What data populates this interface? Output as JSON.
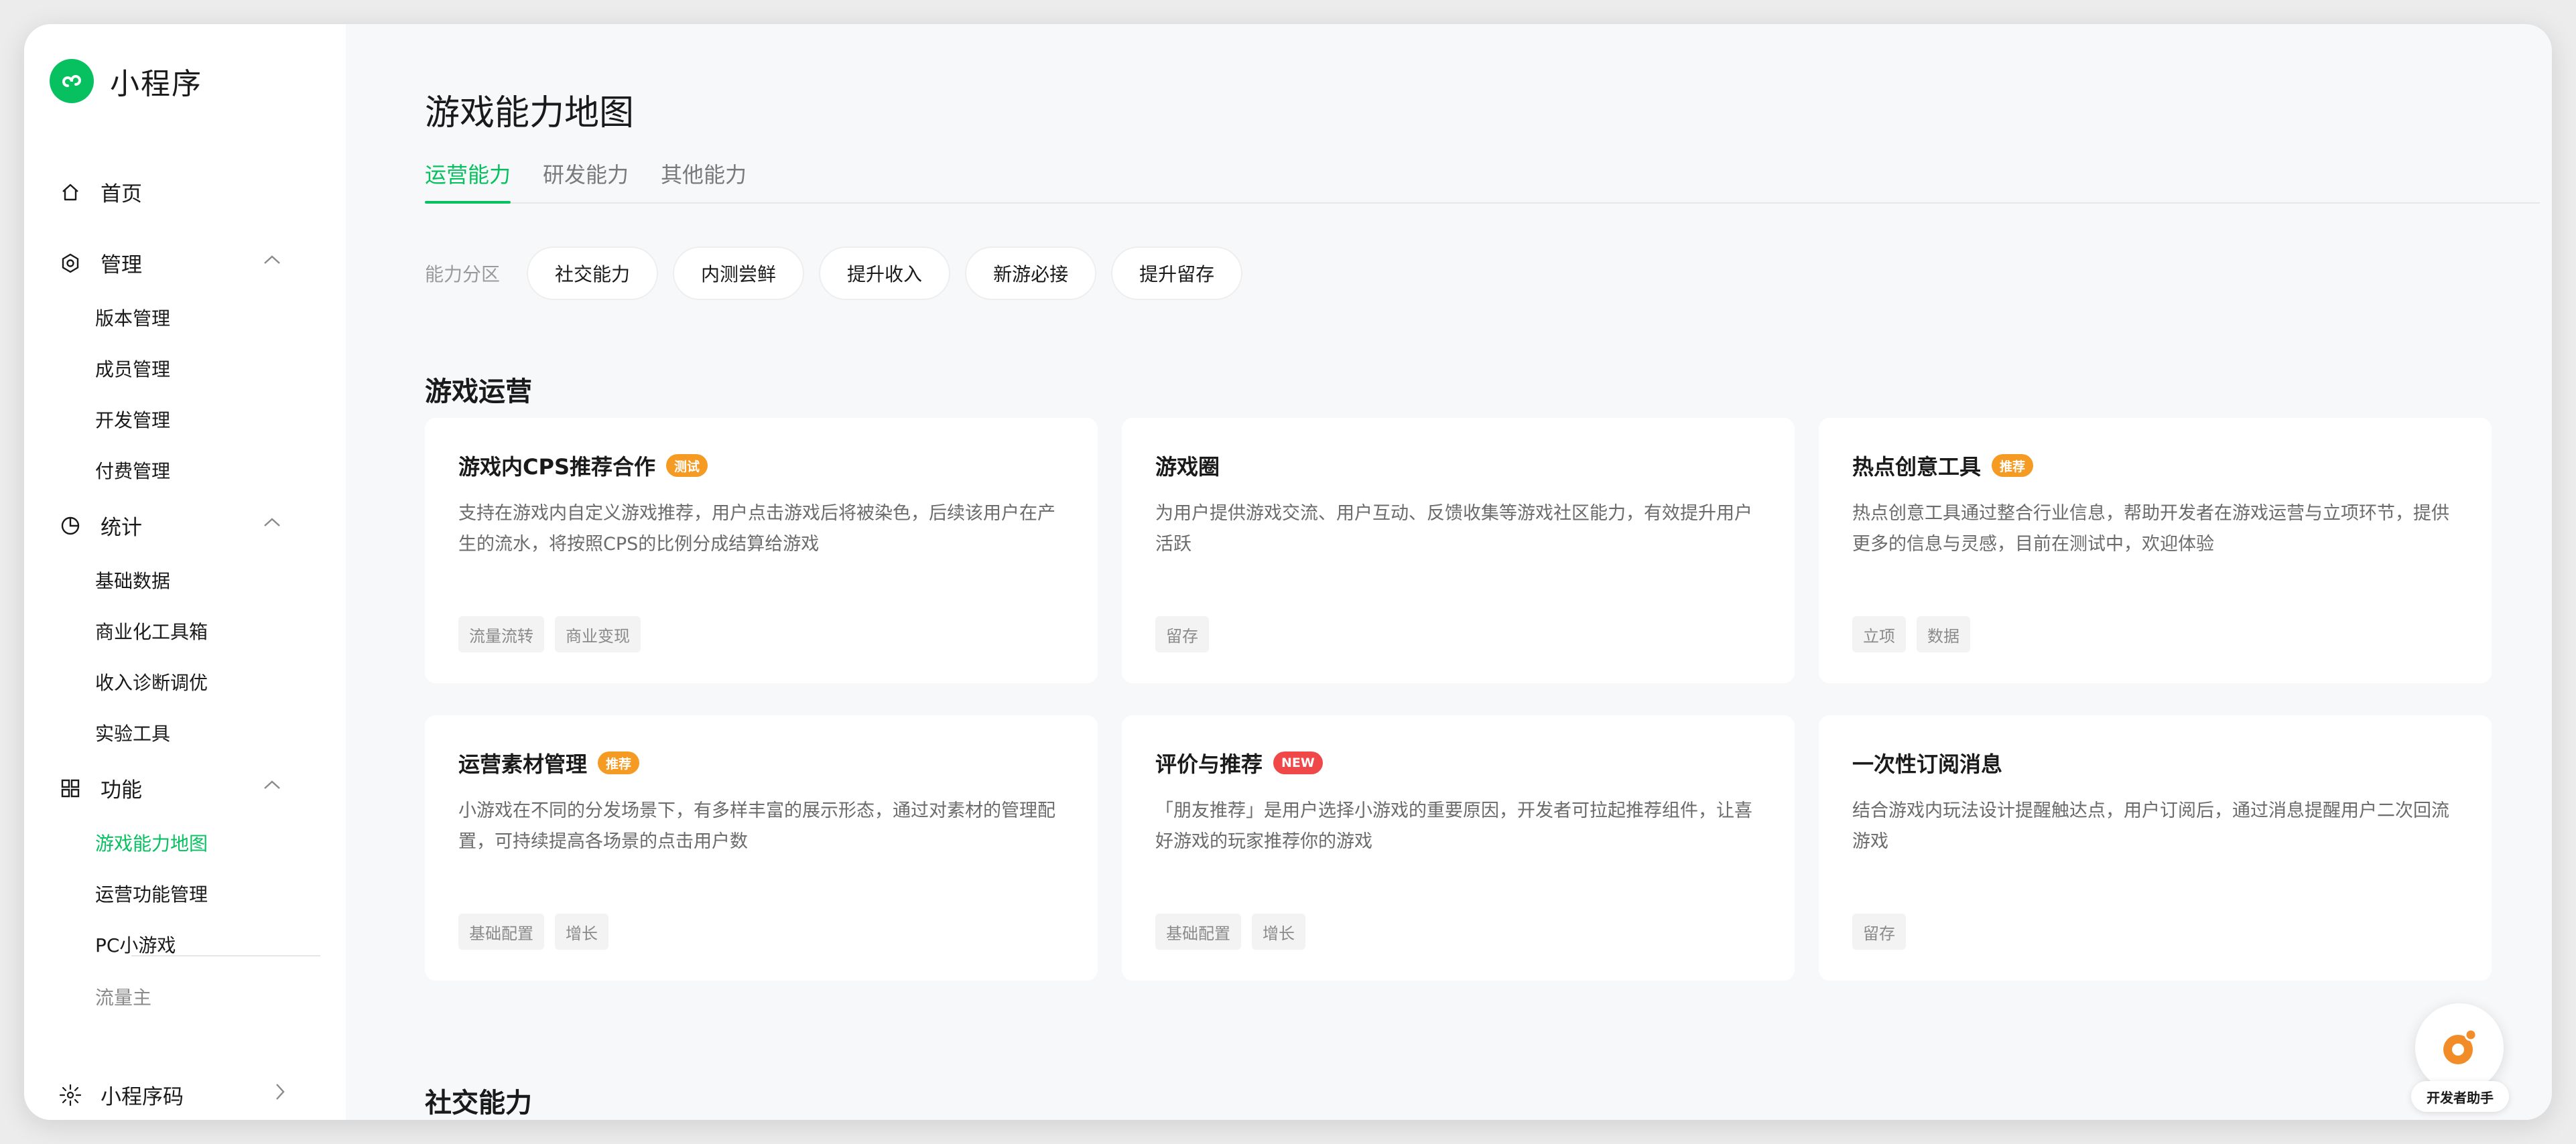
{
  "app": {
    "name": "小程序"
  },
  "sidebar": {
    "home": "首页",
    "groups": [
      {
        "label": "管理",
        "items": [
          "版本管理",
          "成员管理",
          "开发管理",
          "付费管理"
        ]
      },
      {
        "label": "统计",
        "items": [
          "基础数据",
          "商业化工具箱",
          "收入诊断调优",
          "实验工具"
        ]
      },
      {
        "label": "功能",
        "items": [
          "游戏能力地图",
          "运营功能管理",
          "PC小游戏"
        ]
      }
    ],
    "extra": "流量主",
    "bottom": "小程序码"
  },
  "page": {
    "title": "游戏能力地图",
    "tabs": [
      "运营能力",
      "研发能力",
      "其他能力"
    ],
    "filter_label": "能力分区",
    "filters": [
      "社交能力",
      "内测尝鲜",
      "提升收入",
      "新游必接",
      "提升留存"
    ]
  },
  "sections": [
    {
      "title": "游戏运营",
      "cards": [
        {
          "title": "游戏内CPS推荐合作",
          "badge": "测试",
          "desc": "支持在游戏内自定义游戏推荐，用户点击游戏后将被染色，后续该用户在产生的流水，将按照CPS的比例分成结算给游戏",
          "tags": [
            "流量流转",
            "商业变现"
          ]
        },
        {
          "title": "游戏圈",
          "badge": "",
          "desc": "为用户提供游戏交流、用户互动、反馈收集等游戏社区能力，有效提升用户活跃",
          "tags": [
            "留存"
          ]
        },
        {
          "title": "热点创意工具",
          "badge": "推荐",
          "desc": "热点创意工具通过整合行业信息，帮助开发者在游戏运营与立项环节，提供更多的信息与灵感，目前在测试中，欢迎体验",
          "tags": [
            "立项",
            "数据"
          ]
        },
        {
          "title": "运营素材管理",
          "badge": "推荐",
          "desc": "小游戏在不同的分发场景下，有多样丰富的展示形态，通过对素材的管理配置，可持续提高各场景的点击用户数",
          "tags": [
            "基础配置",
            "增长"
          ]
        },
        {
          "title": "评价与推荐",
          "badge": "NEW",
          "desc": "「朋友推荐」是用户选择小游戏的重要原因，开发者可拉起推荐组件，让喜好游戏的玩家推荐你的游戏",
          "tags": [
            "基础配置",
            "增长"
          ]
        },
        {
          "title": "一次性订阅消息",
          "badge": "",
          "desc": "结合游戏内玩法设计提醒触达点，用户订阅后，通过消息提醒用户二次回流游戏",
          "tags": [
            "留存"
          ]
        }
      ]
    },
    {
      "title": "社交能力",
      "cards": []
    }
  ],
  "assistant": {
    "label": "开发者助手"
  },
  "colors": {
    "accent": "#07c160",
    "badge_orange": "#f59a23",
    "badge_red": "#f04848"
  }
}
